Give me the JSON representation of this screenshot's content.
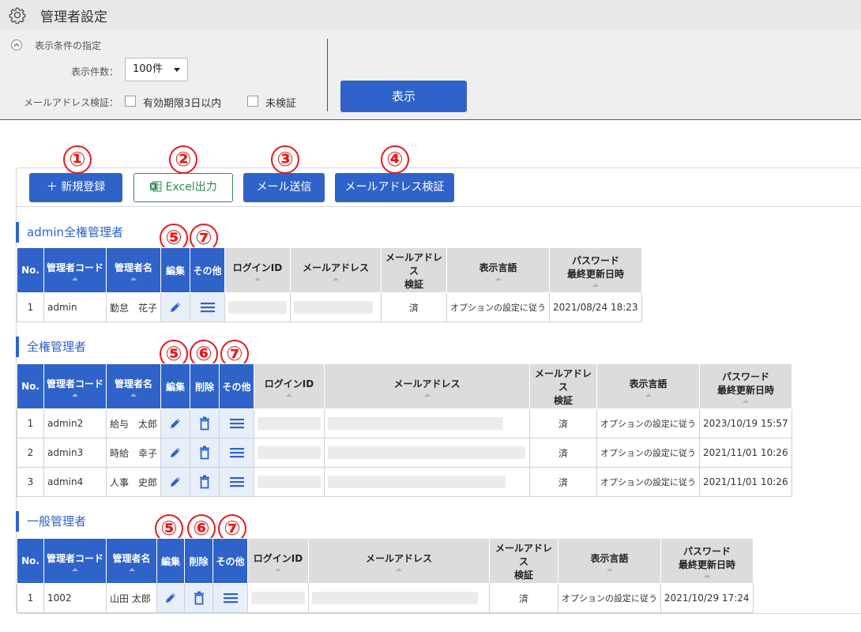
{
  "header": {
    "title": "管理者設定",
    "icon": "gear-icon"
  },
  "conditions": {
    "title": "表示条件の指定",
    "count_label": "表示件数：",
    "count_value": "100件",
    "email_check_label": "メールアドレス検証：",
    "checkbox_expiring": "有効期限3日以内",
    "checkbox_unverified": "未検証",
    "show_button": "表示"
  },
  "toolbar": {
    "new_label": "＋ 新規登録",
    "excel_label": "Excel出力",
    "mail_label": "メール送信",
    "verify_label": "メールアドレス検証"
  },
  "markers": [
    "①",
    "②",
    "③",
    "④",
    "⑤",
    "⑥",
    "⑦"
  ],
  "columns": {
    "no": "No.",
    "code": "管理者コード",
    "name": "管理者名",
    "edit": "編集",
    "delete": "削除",
    "other": "その他",
    "login": "ログインID",
    "email": "メールアドレス",
    "verify": [
      "メールアドレス",
      "検証"
    ],
    "lang": "表示言語",
    "pwd": [
      "パスワード",
      "最終更新日時"
    ]
  },
  "sections": [
    {
      "title": "admin全権管理者",
      "rows": [
        {
          "no": "1",
          "code": "admin",
          "name": "勤怠　花子",
          "verified": "済",
          "lang": "オプションの設定に従う",
          "updated": "2021/08/24 18:23"
        }
      ]
    },
    {
      "title": "全権管理者",
      "rows": [
        {
          "no": "1",
          "code": "admin2",
          "name": "給与　太郎",
          "verified": "済",
          "lang": "オプションの設定に従う",
          "updated": "2023/10/19 15:57"
        },
        {
          "no": "2",
          "code": "admin3",
          "name": "時給　幸子",
          "verified": "済",
          "lang": "オプションの設定に従う",
          "updated": "2021/11/01 10:26"
        },
        {
          "no": "3",
          "code": "admin4",
          "name": "人事　史郎",
          "verified": "済",
          "lang": "オプションの設定に従う",
          "updated": "2021/11/01 10:26"
        }
      ]
    },
    {
      "title": "一般管理者",
      "rows": [
        {
          "no": "1",
          "code": "1002",
          "name": "山田 太郎",
          "verified": "済",
          "lang": "オプションの設定に従う",
          "updated": "2021/10/29 17:24"
        }
      ]
    }
  ]
}
